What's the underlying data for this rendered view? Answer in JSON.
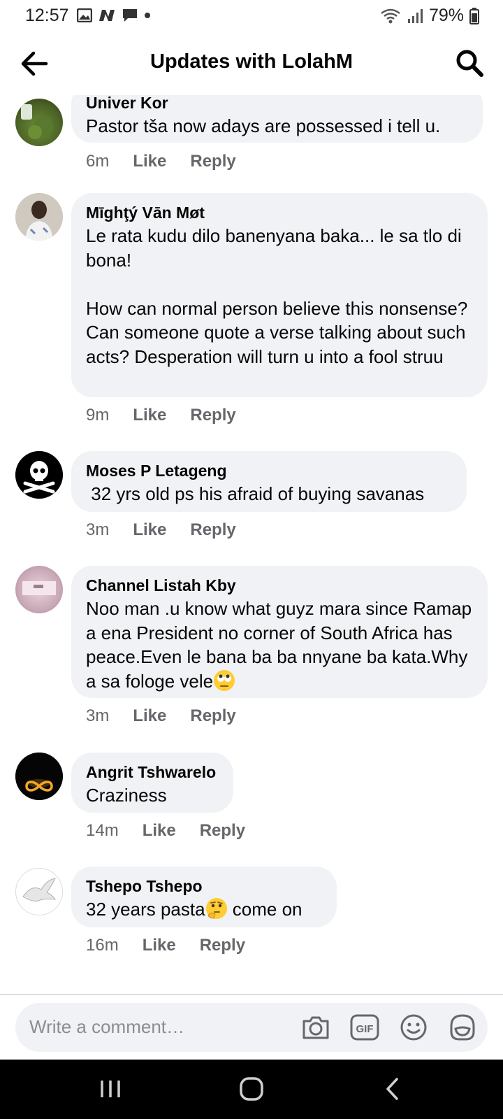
{
  "status_bar": {
    "time": "12:57",
    "battery": "79%",
    "icons": [
      "gallery-icon",
      "n-app-icon",
      "message-icon",
      "dot-icon",
      "wifi-icon",
      "signal-icon",
      "battery-icon"
    ]
  },
  "header": {
    "title": "Updates with LolahM",
    "back_icon": "arrow-left-icon",
    "search_icon": "search-icon"
  },
  "comments": [
    {
      "name": "Univer Kor",
      "text": "Pastor tša now adays are possessed i tell u.",
      "time": "6m",
      "like": "Like",
      "reply": "Reply"
    },
    {
      "name": "Mīghţý Vān Møt",
      "text": "Le rata kudu dilo banenyana baka... le sa tlo di bona!\n\nHow can normal person believe this nonsense? Can someone quote a verse talking about such acts? Desperation will turn u into a fool struu",
      "time": "9m",
      "like": "Like",
      "reply": "Reply"
    },
    {
      "name": "Moses P Letageng",
      "text": " 32 yrs old ps his afraid of buying savanas",
      "time": "3m",
      "like": "Like",
      "reply": "Reply"
    },
    {
      "name": "Channel Listah Kby",
      "text": "Noo man .u know what guyz mara since Ramap a ena President no corner of South Africa has peace.Even le bana ba ba nnyane ba kata.Why a sa fologe vele",
      "emoji": "rolling-eyes-emoji",
      "time": "3m",
      "like": "Like",
      "reply": "Reply"
    },
    {
      "name": "Angrit Tshwarelo",
      "text": "Craziness",
      "time": "14m",
      "like": "Like",
      "reply": "Reply"
    },
    {
      "name": "Tshepo Tshepo",
      "text_before": "32 years pasta",
      "emoji": "thinking-face-emoji",
      "text_after": " come on",
      "time": "16m",
      "like": "Like",
      "reply": "Reply"
    }
  ],
  "composer": {
    "placeholder": "Write a comment…",
    "icons": [
      "camera-icon",
      "gif-icon",
      "smiley-icon",
      "sticker-icon"
    ]
  },
  "navbar": {
    "icons": [
      "recent-apps-icon",
      "home-icon",
      "back-icon"
    ]
  },
  "colors": {
    "bubble": "#f0f2f5",
    "meta_text": "#65676b",
    "placeholder": "#8a8d91"
  }
}
